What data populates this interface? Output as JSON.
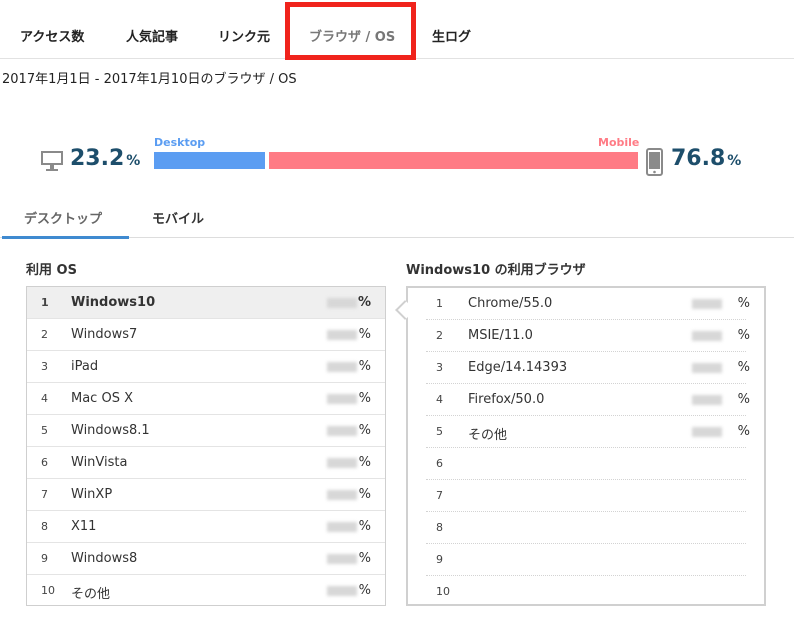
{
  "tabs": [
    {
      "label": "アクセス数"
    },
    {
      "label": "人気記事"
    },
    {
      "label": "リンク元"
    },
    {
      "label": "ブラウザ / OS"
    },
    {
      "label": "生ログ"
    }
  ],
  "date_range": "2017年1月1日 - 2017年1月10日のブラウザ / OS",
  "ratio": {
    "desktop_value": "23.2",
    "mobile_value": "76.8",
    "percent_sign": "%",
    "desktop_label": "Desktop",
    "mobile_label": "Mobile",
    "desktop_color": "#5b9df2",
    "mobile_color": "#ff7b85"
  },
  "sub_tabs": [
    {
      "label": "デスクトップ"
    },
    {
      "label": "モバイル"
    }
  ],
  "os_panel": {
    "title": "利用 OS",
    "items": [
      {
        "rank": "1",
        "name": "Windows10",
        "pct": "%"
      },
      {
        "rank": "2",
        "name": "Windows7",
        "pct": "%"
      },
      {
        "rank": "3",
        "name": "iPad",
        "pct": "%"
      },
      {
        "rank": "4",
        "name": "Mac OS X",
        "pct": "%"
      },
      {
        "rank": "5",
        "name": "Windows8.1",
        "pct": "%"
      },
      {
        "rank": "6",
        "name": "WinVista",
        "pct": "%"
      },
      {
        "rank": "7",
        "name": "WinXP",
        "pct": "%"
      },
      {
        "rank": "8",
        "name": "X11",
        "pct": "%"
      },
      {
        "rank": "9",
        "name": "Windows8",
        "pct": "%"
      },
      {
        "rank": "10",
        "name": "その他",
        "pct": "%"
      }
    ]
  },
  "browser_panel": {
    "title": "Windows10 の利用ブラウザ",
    "items": [
      {
        "rank": "1",
        "name": "Chrome/55.0",
        "pct": "%"
      },
      {
        "rank": "2",
        "name": "MSIE/11.0",
        "pct": "%"
      },
      {
        "rank": "3",
        "name": "Edge/14.14393",
        "pct": "%"
      },
      {
        "rank": "4",
        "name": "Firefox/50.0",
        "pct": "%"
      },
      {
        "rank": "5",
        "name": "その他",
        "pct": "%"
      },
      {
        "rank": "6",
        "name": "",
        "pct": ""
      },
      {
        "rank": "7",
        "name": "",
        "pct": ""
      },
      {
        "rank": "8",
        "name": "",
        "pct": ""
      },
      {
        "rank": "9",
        "name": "",
        "pct": ""
      },
      {
        "rank": "10",
        "name": "",
        "pct": ""
      }
    ]
  }
}
